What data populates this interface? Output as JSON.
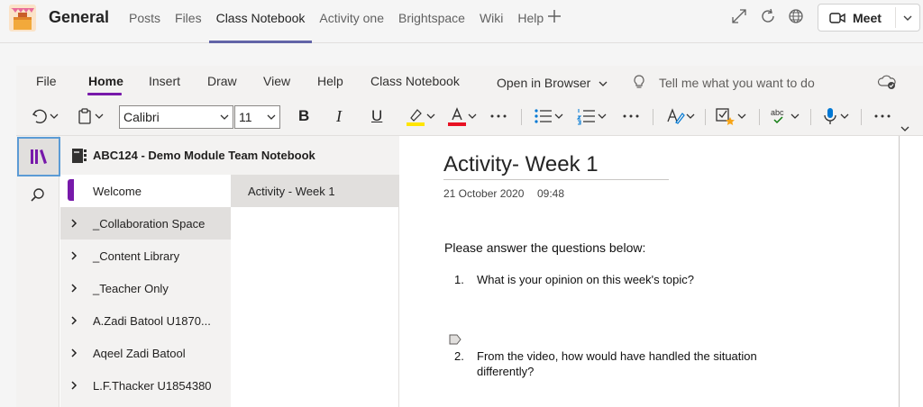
{
  "teams": {
    "channel": "General",
    "tabs": [
      "Posts",
      "Files",
      "Class Notebook",
      "Activity one",
      "Brightspace",
      "Wiki",
      "Help"
    ],
    "active_tab": "Class Notebook",
    "meet_label": "Meet",
    "accent": "#6264a7"
  },
  "onenote": {
    "menu": [
      "File",
      "Home",
      "Insert",
      "Draw",
      "View",
      "Help",
      "Class Notebook",
      "Open in Browser"
    ],
    "active_menu": "Home",
    "tell_me": "Tell me what you want to do",
    "font_name": "Calibri",
    "font_size": "11",
    "bold": "B",
    "italic": "I",
    "underline": "U",
    "accent": "#7719aa"
  },
  "notebook": {
    "title": "ABC124 - Demo Module Team Notebook",
    "sections": [
      {
        "label": "Welcome",
        "state": "selected"
      },
      {
        "label": "_Collaboration Space",
        "state": "hover"
      },
      {
        "label": "_Content Library",
        "state": ""
      },
      {
        "label": "_Teacher Only",
        "state": ""
      },
      {
        "label": "A.Zadi Batool U1870...",
        "state": ""
      },
      {
        "label": "Aqeel Zadi Batool",
        "state": ""
      },
      {
        "label": "L.F.Thacker U1854380",
        "state": ""
      }
    ],
    "pages": [
      {
        "label": "Activity - Week 1"
      }
    ]
  },
  "page": {
    "title": "Activity- Week 1",
    "date": "21 October 2020",
    "time": "09:48",
    "intro": "Please answer the questions below:",
    "questions": [
      {
        "num": "1.",
        "text": "What is your opinion on this week's topic?"
      },
      {
        "num": "2.",
        "line1": "From the video, how would have handled the situation",
        "line2": "differently?"
      }
    ]
  }
}
